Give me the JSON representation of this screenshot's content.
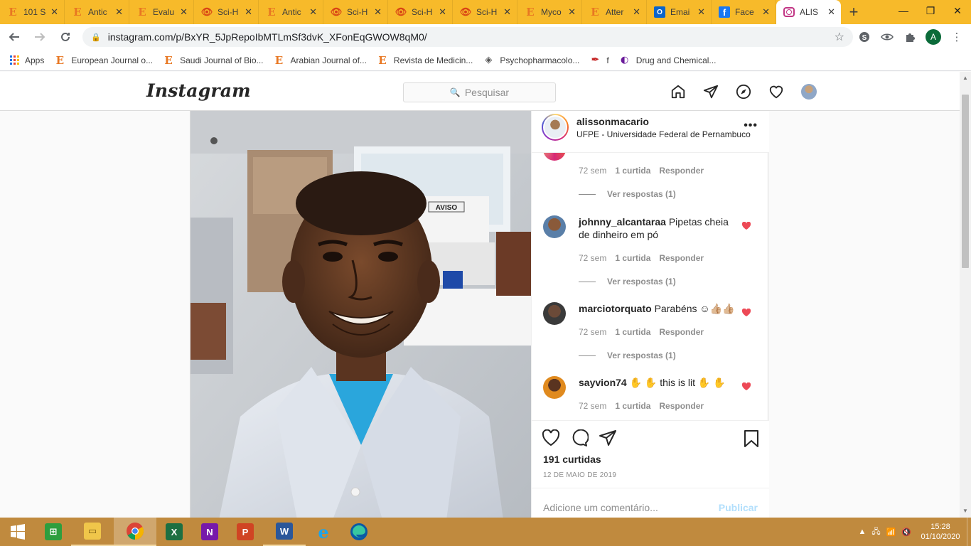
{
  "browser": {
    "tabs": [
      {
        "icon": "elsevier-icon",
        "title": "101 S",
        "active": false
      },
      {
        "icon": "elsevier-icon",
        "title": "Antic",
        "active": false
      },
      {
        "icon": "elsevier-icon",
        "title": "Evalu",
        "active": false
      },
      {
        "icon": "scihub-icon",
        "title": "Sci-H",
        "active": false
      },
      {
        "icon": "elsevier-icon",
        "title": "Antic",
        "active": false
      },
      {
        "icon": "scihub-icon",
        "title": "Sci-H",
        "active": false
      },
      {
        "icon": "scihub-icon",
        "title": "Sci-H",
        "active": false
      },
      {
        "icon": "scihub-icon",
        "title": "Sci-H",
        "active": false
      },
      {
        "icon": "elsevier-icon",
        "title": "Myco",
        "active": false
      },
      {
        "icon": "elsevier-icon",
        "title": "Atter",
        "active": false
      },
      {
        "icon": "outlook-icon",
        "title": "Emai",
        "active": false
      },
      {
        "icon": "facebook-icon",
        "title": "Face",
        "active": false
      },
      {
        "icon": "instagram-icon",
        "title": "ALIS",
        "active": true
      }
    ],
    "url": "instagram.com/p/BxYR_5JpRepoIbMTLmSf3dvK_XFonEqGWOW8qM0/",
    "profile_initial": "A",
    "bookmarks": [
      {
        "icon": "apps-icon",
        "label": "Apps"
      },
      {
        "icon": "elsevier-icon",
        "label": "European Journal o..."
      },
      {
        "icon": "elsevier-icon",
        "label": "Saudi Journal of Bio..."
      },
      {
        "icon": "elsevier-icon",
        "label": "Arabian Journal of..."
      },
      {
        "icon": "elsevier-icon",
        "label": "Revista de Medicin..."
      },
      {
        "icon": "psychopharm-icon",
        "label": "Psychopharmacolo..."
      },
      {
        "icon": "feather-icon",
        "label": "f"
      },
      {
        "icon": "drug-icon",
        "label": "Drug and Chemical..."
      }
    ]
  },
  "instagram": {
    "logo": "Instagram",
    "search_placeholder": "Pesquisar",
    "post": {
      "username": "alissonmacario",
      "location": "UFPE - Universidade Federal de Pernambuco",
      "comments": [
        {
          "username": "",
          "text": "",
          "time": "72 sem",
          "likes": "1 curtida",
          "reply": "Responder",
          "replies": "Ver respostas (1)",
          "liked": false
        },
        {
          "username": "johnny_alcantaraa",
          "text": "Pipetas cheia de dinheiro em pó",
          "time": "72 sem",
          "likes": "1 curtida",
          "reply": "Responder",
          "replies": "Ver respostas (1)",
          "liked": true
        },
        {
          "username": "marciotorquato",
          "text": "Parabéns ☺👍🏼👍🏼",
          "time": "72 sem",
          "likes": "1 curtida",
          "reply": "Responder",
          "replies": "Ver respostas (1)",
          "liked": true
        },
        {
          "username": "sayvion74",
          "text": "✋ ✋ this is lit ✋ ✋",
          "time": "72 sem",
          "likes": "1 curtida",
          "reply": "Responder",
          "replies": "",
          "liked": true
        }
      ],
      "likes": "191 curtidas",
      "date": "12 DE MAIO DE 2019",
      "comment_placeholder": "Adicione um comentário...",
      "publish": "Publicar"
    },
    "photo_sign": "AVISO"
  },
  "taskbar": {
    "time": "15:28",
    "date": "01/10/2020"
  },
  "colors": {
    "tabstrip": "#f7ba2a",
    "taskbar": "#c08a3e",
    "heart": "#ed4956",
    "publish": "#b2dffc"
  }
}
